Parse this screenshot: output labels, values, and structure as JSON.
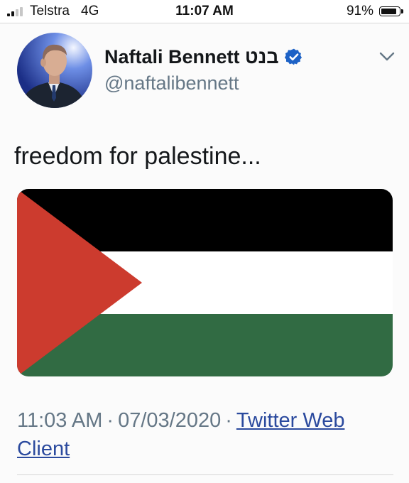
{
  "status_bar": {
    "carrier": "Telstra",
    "network": "4G",
    "time": "11:07 AM",
    "battery_percent": "91%",
    "battery_level": 0.91,
    "signal_bars_filled": 2,
    "signal_bars_total": 4
  },
  "tweet": {
    "display_name": "Naftali Bennett בנט",
    "handle": "@naftalibennett",
    "verified": true,
    "text": "freedom for palestine...",
    "timestamp_time": "11:03 AM",
    "separator": "·",
    "timestamp_date": "07/03/2020",
    "source": "Twitter Web Client",
    "media": {
      "icon": "palestinian-flag-image",
      "stripe_colors": [
        "#000000",
        "#ffffff",
        "#316b43"
      ],
      "triangle_color": "#cc3b2e"
    }
  },
  "icons": {
    "verified": "verified-badge-icon",
    "more": "chevron-down-icon"
  },
  "colors": {
    "verified_blue": "#1d62c6",
    "link": "#2b4a9e",
    "secondary_text": "#657786"
  }
}
